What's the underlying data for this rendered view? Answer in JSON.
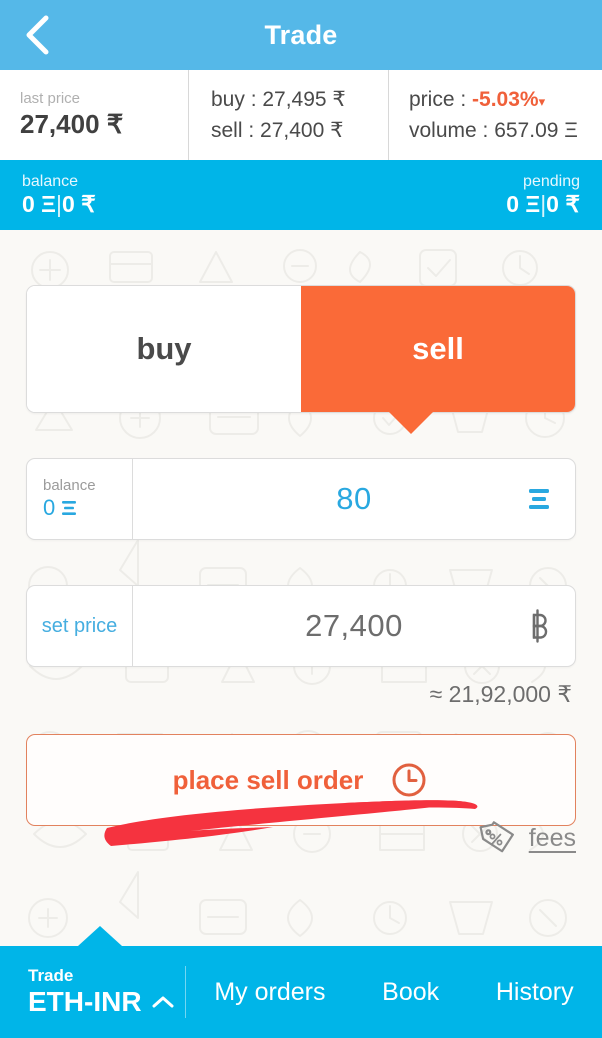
{
  "header": {
    "title": "Trade",
    "back_icon": "chevron-left-icon"
  },
  "ticker": {
    "last_price_label": "last price",
    "last_price_value": "27,400 ₹",
    "buy_row": "buy : 27,495 ₹",
    "sell_row": "sell  : 27,400 ₹",
    "price_label": "price : ",
    "price_change": "-5.03%",
    "price_change_icon": "chevron-down-icon",
    "volume_row": "volume : 657.09 Ξ"
  },
  "balance_bar": {
    "balance_label": "balance",
    "balance_crypto": "0 Ξ",
    "balance_sep": "|",
    "balance_fiat": "0 ₹",
    "pending_label": "pending",
    "pending_crypto": "0 Ξ",
    "pending_sep": "|",
    "pending_fiat": "0 ₹"
  },
  "toggle": {
    "buy_label": "buy",
    "sell_label": "sell",
    "active": "sell"
  },
  "amount_field": {
    "balance_caption": "balance",
    "balance_value": "0",
    "balance_unit_icon": "ethereum-icon",
    "value": "80",
    "unit_icon": "ethereum-icon"
  },
  "price_field": {
    "label": "set price",
    "value": "27,400",
    "unit_icon": "baht-icon"
  },
  "total": {
    "approx": "≈ 21,92,000 ₹"
  },
  "order": {
    "label": "place sell order",
    "clock_icon": "clock-icon"
  },
  "fees": {
    "label": "fees",
    "icon": "percent-tag-icon"
  },
  "bottom_nav": {
    "pair_caption": "Trade",
    "pair_value": "ETH-INR",
    "pair_chevron": "chevron-up-icon",
    "items": [
      {
        "label": "My orders"
      },
      {
        "label": "Book"
      },
      {
        "label": "History"
      }
    ]
  },
  "colors": {
    "header_blue": "#55b8e8",
    "bar_blue": "#00b5e8",
    "orange": "#fa6a38",
    "orange_text": "#f0603a",
    "link_blue": "#29a8e0",
    "annotation_red": "#f5333f",
    "page_bg": "#faf9f6"
  }
}
